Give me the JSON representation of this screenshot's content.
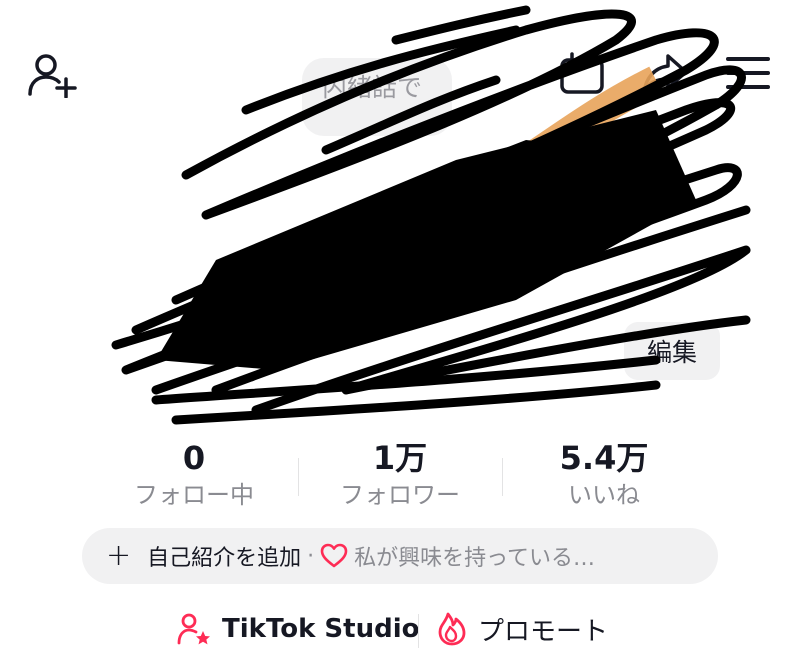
{
  "profile": {
    "note_text": "内緒話で",
    "edit_label": "編集"
  },
  "stats": {
    "following": {
      "value": "0",
      "label": "フォロー中"
    },
    "followers": {
      "value": "1万",
      "label": "フォロワー"
    },
    "likes": {
      "value": "5.4万",
      "label": "いいね"
    }
  },
  "bio": {
    "add_label": "自己紹介を追加",
    "separator": "·",
    "interest_label": "私が興味を持っている…"
  },
  "actions": {
    "studio_label": "TikTok Studio",
    "promote_label": "プロモート"
  },
  "colors": {
    "accent": "#fe2c55",
    "text": "#161823",
    "secondary_text": "#8a8b91",
    "pill_bg": "#f1f1f2"
  },
  "icons": {
    "top_left": "add-friend-icon",
    "top_right": [
      "calendar-icon",
      "share-icon",
      "menu-icon"
    ],
    "bio": [
      "plus-icon",
      "heart-icon"
    ],
    "studio": "person-star-icon",
    "promote": "flame-icon"
  }
}
